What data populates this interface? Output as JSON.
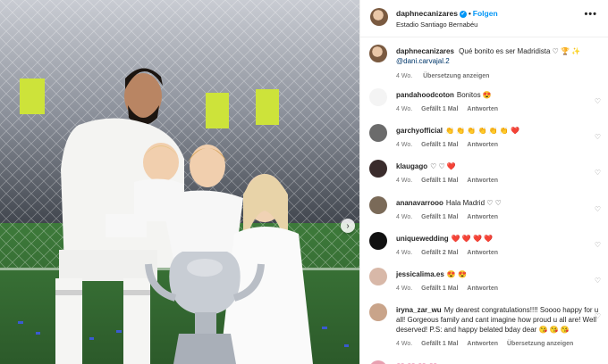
{
  "header": {
    "username": "daphnecanizares",
    "follow_label": "Folgen",
    "location": "Estadio Santiago Bernabéu",
    "more_icon": "•••",
    "separator": "•"
  },
  "caption": {
    "username": "daphnecanizares",
    "text": "Qué bonito es ser Madridista",
    "emojis": "♡ 🏆 ✨",
    "mention": "@dani.carvajal.2",
    "time": "4 Wo.",
    "translate": "Übersetzung anzeigen"
  },
  "comments": [
    {
      "user": "pandahoodcoton",
      "text": "Bonitos",
      "emojis": "😍",
      "time": "4 Wo.",
      "likes": "Gefällt 1 Mal",
      "reply": "Antworten",
      "avatar_color": "#f4f4f4"
    },
    {
      "user": "garchyofficial",
      "text": "",
      "emojis": "👏 👏 👏 👏 👏 👏 ❤️",
      "time": "4 Wo.",
      "likes": "Gefällt 1 Mal",
      "reply": "Antworten",
      "avatar_color": "#6b6b6b"
    },
    {
      "user": "klaugago",
      "text": "",
      "emojis": "♡ ♡ ❤️",
      "time": "4 Wo.",
      "likes": "Gefällt 1 Mal",
      "reply": "Antworten",
      "avatar_color": "#3a2c2c"
    },
    {
      "user": "ananavarrooo",
      "text": "Hala Madrid",
      "emojis": "♡ ♡",
      "time": "4 Wo.",
      "likes": "Gefällt 1 Mal",
      "reply": "Antworten",
      "avatar_color": "#7a6a58"
    },
    {
      "user": "uniquewedding",
      "text": "",
      "emojis": "❤️ ❤️ ❤️ ❤️",
      "time": "4 Wo.",
      "likes": "Gefällt 2 Mal",
      "reply": "Antworten",
      "avatar_color": "#111111"
    },
    {
      "user": "jessicalima.es",
      "text": "",
      "emojis": "😍 😍",
      "time": "4 Wo.",
      "likes": "Gefällt 1 Mal",
      "reply": "Antworten",
      "avatar_color": "#d8b8a8"
    },
    {
      "user": "iryna_zar_wu",
      "text": "My dearest congratulations!!!! Soooo happy for u all! Gorgeous family and cant imagine how proud u all are! Well deserved! P.S: and happy belated bday dear",
      "emojis": "😘 😘 😘",
      "time": "4 Wo.",
      "likes": "Gefällt 1 Mal",
      "reply": "Antworten",
      "translate": "Übersetzung anzeigen",
      "avatar_color": "#c9a48a"
    },
    {
      "user": "",
      "text": "",
      "emojis": "💗 💗 💗 💗",
      "avatar_color": "#e8a0b0"
    }
  ],
  "colors": {
    "accent": "#0095f6",
    "heart": "#ed4956",
    "meta": "#737373"
  },
  "icons": {
    "next": "chevron-right-icon",
    "like": "heart-outline-icon"
  }
}
